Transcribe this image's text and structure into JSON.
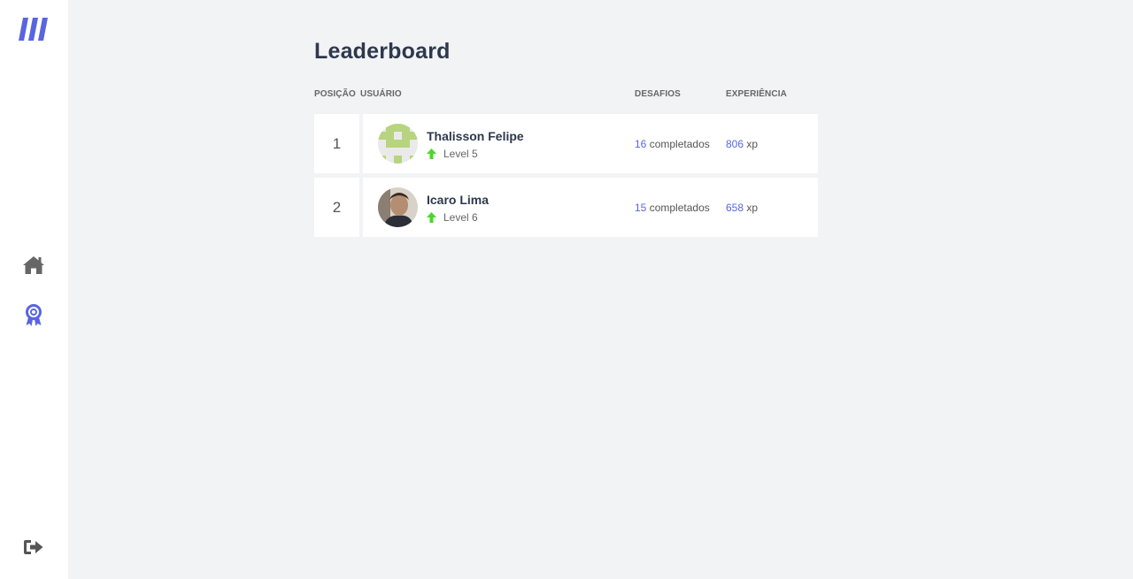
{
  "page": {
    "title": "Leaderboard"
  },
  "sidebar": {
    "logo_icon": "moveit-logo-icon",
    "items": [
      {
        "icon": "home-icon",
        "active": false
      },
      {
        "icon": "award-icon",
        "active": true
      }
    ],
    "logout_icon": "logout-icon"
  },
  "table": {
    "headers": {
      "position": "POSIÇÃO",
      "user": "USUÁRIO",
      "challenges": "DESAFIOS",
      "experience": "EXPERIÊNCIA"
    },
    "rows": [
      {
        "position": "1",
        "name": "Thalisson Felipe",
        "level": "Level 5",
        "challenges_count": "16",
        "challenges_suffix": "completados",
        "xp": "806",
        "xp_suffix": "xp"
      },
      {
        "position": "2",
        "name": "Icaro Lima",
        "level": "Level 6",
        "challenges_count": "15",
        "challenges_suffix": "completados",
        "xp": "658",
        "xp_suffix": "xp"
      }
    ]
  },
  "colors": {
    "accent": "#5965e0",
    "level_up": "#4cd62b",
    "background": "#f2f3f5",
    "text": "#2e384d"
  }
}
